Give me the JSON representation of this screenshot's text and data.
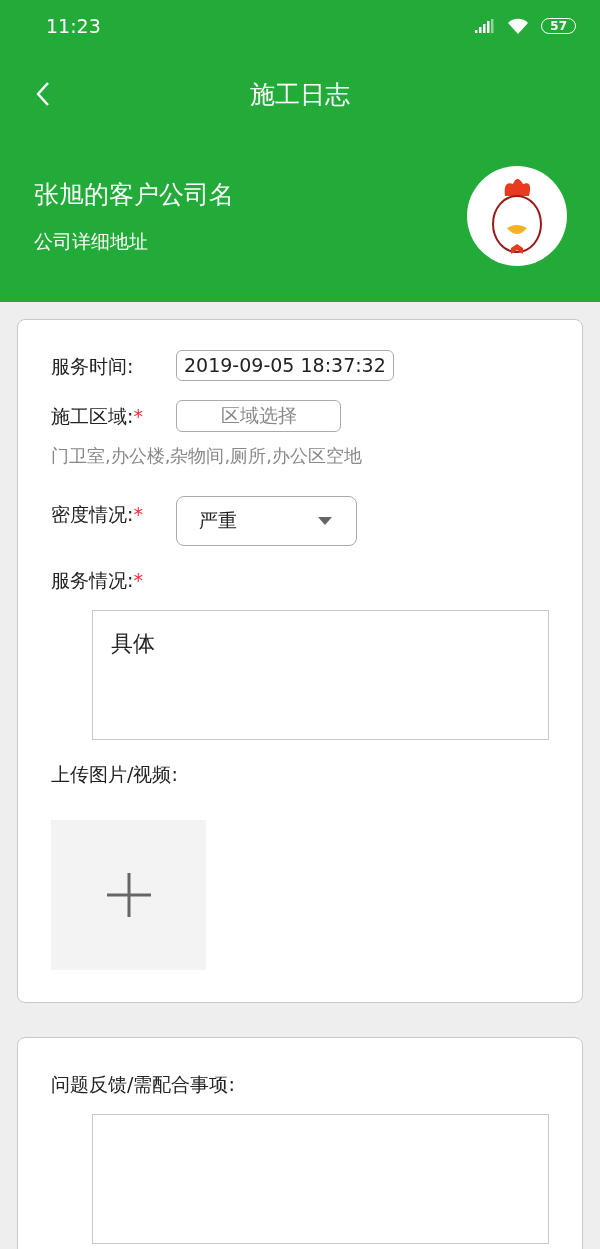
{
  "status_bar": {
    "time": "11:23",
    "battery": "57"
  },
  "header": {
    "title": "施工日志",
    "company": "张旭的客户公司名",
    "address": "公司详细地址"
  },
  "cards": [
    {
      "fields": [
        {
          "kind": "value",
          "label": "服务时间:",
          "value": "2019-09-05 18:37:32"
        },
        {
          "kind": "picker",
          "label": "施工区域:",
          "required_mark": "*",
          "placeholder": "区域选择",
          "note": "门卫室,办公楼,杂物间,厕所,办公区空地"
        },
        {
          "kind": "dropdown",
          "label": "密度情况:",
          "required_mark": "*",
          "value": "严重"
        },
        {
          "kind": "textarea",
          "label": "服务情况:",
          "required_mark": "*",
          "value": "具体"
        },
        {
          "kind": "upload",
          "label": "上传图片/视频:"
        }
      ]
    },
    {
      "fields": [
        {
          "kind": "textarea",
          "label": "问题反馈/需配合事项:"
        }
      ]
    }
  ]
}
